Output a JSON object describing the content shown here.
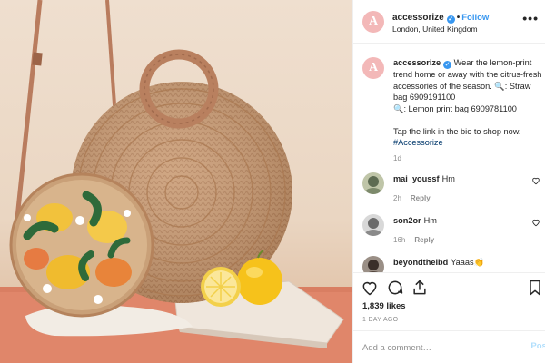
{
  "brand": {
    "avatar_letter": "A",
    "avatar_color": "#f3b8b8"
  },
  "header": {
    "username": "accessorize",
    "verified_icon": "verified-badge-icon",
    "separator": "•",
    "follow_label": "Follow",
    "location": "London, United Kingdom",
    "more_icon": "more-options-icon",
    "more_glyph": "•••"
  },
  "caption": {
    "username": "accessorize",
    "text_1": "Wear the lemon-print trend home or away with the citrus-fresh accessories of the season. 🔍: Straw bag 6909191100",
    "text_2": "🔍: Lemon print bag 6909781100",
    "text_3": "Tap the link in the bio to shop now.",
    "hashtag": "#Accessorize",
    "time": "1d"
  },
  "comments": [
    {
      "username": "mai_youssf",
      "text": "Hm",
      "time": "2h",
      "reply": "Reply"
    },
    {
      "username": "son2or",
      "text": "Hm",
      "time": "16h",
      "reply": "Reply"
    },
    {
      "username": "beyondthelbd",
      "text": "Yaaas👏",
      "time": "",
      "reply": ""
    }
  ],
  "actions": {
    "icons": [
      "heart-icon",
      "comment-icon",
      "share-icon",
      "bookmark-icon"
    ],
    "likes": "1,839 likes",
    "ago": "1 DAY AGO"
  },
  "add_comment": {
    "placeholder": "Add a comment…",
    "post_label": "Post"
  },
  "colors": {
    "link_blue": "#3897f0",
    "hashtag": "#00376b",
    "muted": "#8e8e8e",
    "post_disabled": "#b2dffc"
  }
}
